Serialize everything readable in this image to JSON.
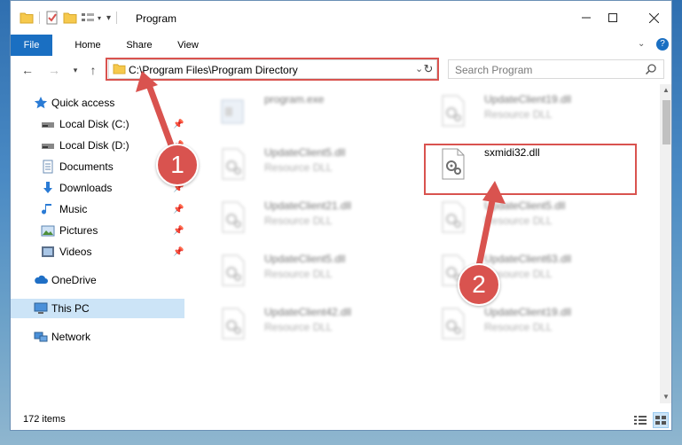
{
  "window": {
    "title": "Program"
  },
  "ribbon": {
    "tabs": [
      "File",
      "Home",
      "Share",
      "View"
    ]
  },
  "address": {
    "path": "C:\\Program Files\\Program Directory"
  },
  "search": {
    "placeholder": "Search Program"
  },
  "nav": {
    "items": [
      {
        "label": "Quick access",
        "icon": "star-icon",
        "pinned": false
      },
      {
        "label": "Local Disk (C:)",
        "icon": "drive-icon",
        "pinned": true
      },
      {
        "label": "Local Disk (D:)",
        "icon": "drive-icon",
        "pinned": true
      },
      {
        "label": "Documents",
        "icon": "document-icon",
        "pinned": true
      },
      {
        "label": "Downloads",
        "icon": "download-icon",
        "pinned": true
      },
      {
        "label": "Music",
        "icon": "music-icon",
        "pinned": true
      },
      {
        "label": "Pictures",
        "icon": "pictures-icon",
        "pinned": true
      },
      {
        "label": "Videos",
        "icon": "video-icon",
        "pinned": true
      },
      {
        "label": "OneDrive",
        "icon": "cloud-icon",
        "pinned": false
      },
      {
        "label": "This PC",
        "icon": "computer-icon",
        "pinned": false,
        "selected": true
      },
      {
        "label": "Network",
        "icon": "network-icon",
        "pinned": false
      }
    ]
  },
  "files": [
    {
      "name": "program.exe",
      "type": "",
      "blurred": true
    },
    {
      "name": "UpdateClient19.dll",
      "type": "Resource DLL",
      "blurred": true
    },
    {
      "name": "UpdateClient5.dll",
      "type": "Resource DLL",
      "blurred": true
    },
    {
      "name": "sxmidi32.dll",
      "type": "",
      "blurred": false,
      "highlighted": true
    },
    {
      "name": "UpdateClient21.dll",
      "type": "Resource DLL",
      "blurred": true
    },
    {
      "name": "UpdateClient5.dll",
      "type": "Resource DLL",
      "blurred": true
    },
    {
      "name": "UpdateClient5.dll",
      "type": "Resource DLL",
      "blurred": true
    },
    {
      "name": "UpdateClient63.dll",
      "type": "Resource DLL",
      "blurred": true
    },
    {
      "name": "UpdateClient42.dll",
      "type": "Resource DLL",
      "blurred": true
    },
    {
      "name": "UpdateClient19.dll",
      "type": "Resource DLL",
      "blurred": true
    }
  ],
  "status": {
    "item_count": "172 items"
  },
  "annotations": {
    "step1": "1",
    "step2": "2",
    "color": "#d9534f"
  },
  "colors": {
    "accent": "#1a6fc2",
    "selection": "#cce4f7"
  }
}
